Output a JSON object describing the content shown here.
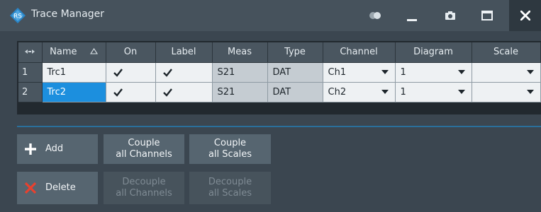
{
  "window": {
    "title": "Trace Manager",
    "icons": [
      "rs-logo-icon",
      "toggle-icon",
      "minimize-icon",
      "camera-icon",
      "maximize-icon",
      "close-icon"
    ]
  },
  "table": {
    "headers": [
      "Name",
      "On",
      "Label",
      "Meas",
      "Type",
      "Channel",
      "Diagram",
      "Scale"
    ],
    "rows": [
      {
        "index": "1",
        "name": "Trc1",
        "on": true,
        "label": true,
        "meas": "S21",
        "type": "DAT",
        "channel": "Ch1",
        "diagram": "1",
        "scale": ""
      },
      {
        "index": "2",
        "name": "Trc2",
        "on": true,
        "label": true,
        "meas": "S21",
        "type": "DAT",
        "channel": "Ch2",
        "diagram": "1",
        "scale": ""
      }
    ]
  },
  "buttons": {
    "add": "Add",
    "delete": "Delete",
    "couple_channels": [
      "Couple",
      "all Channels"
    ],
    "couple_scales": [
      "Couple",
      "all Scales"
    ],
    "decouple_channels": [
      "Decouple",
      "all Channels"
    ],
    "decouple_scales": [
      "Decouple",
      "all Scales"
    ]
  },
  "colors": {
    "background": "#3b4650",
    "selected": "#1c8fde",
    "add_icon": "#ffffff",
    "delete_icon": "#e8412e"
  }
}
